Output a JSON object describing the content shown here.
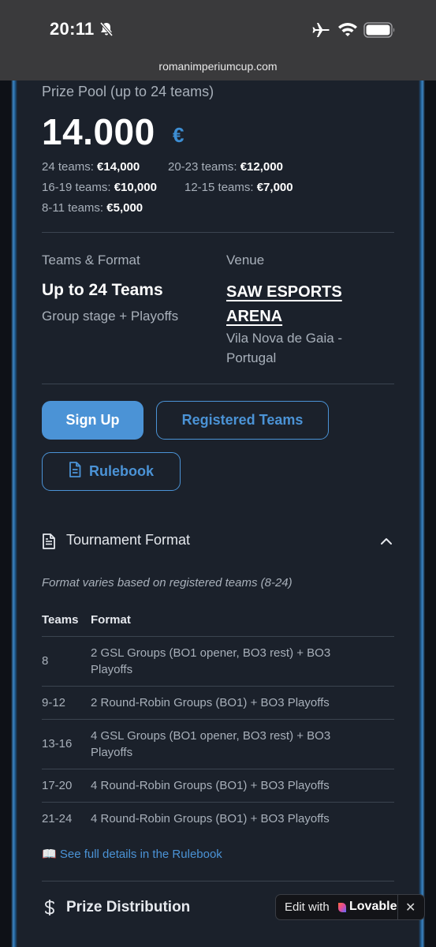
{
  "status_bar": {
    "time": "20:11"
  },
  "browser": {
    "url": "romanimperiumcup.com"
  },
  "prize": {
    "heading": "Prize Pool (up to 24 teams)",
    "amount": "14.000",
    "currency": "€",
    "tiers": [
      {
        "label": "24 teams:",
        "value": "€14,000"
      },
      {
        "label": "20-23 teams:",
        "value": "€12,000"
      },
      {
        "label": "16-19 teams:",
        "value": "€10,000"
      },
      {
        "label": "12-15 teams:",
        "value": "€7,000"
      },
      {
        "label": "8-11 teams:",
        "value": "€5,000"
      }
    ]
  },
  "teams_format": {
    "label": "Teams & Format",
    "value": "Up to 24 Teams",
    "sub": "Group stage + Playoffs"
  },
  "venue": {
    "label": "Venue",
    "name": "SAW ESPORTS ARENA",
    "location": "Vila Nova de Gaia - Portugal"
  },
  "buttons": {
    "signup": "Sign Up",
    "registered": "Registered Teams",
    "rulebook": "Rulebook"
  },
  "tournament_format": {
    "title": "Tournament Format",
    "note": "Format varies based on registered teams (8-24)",
    "columns": [
      "Teams",
      "Format"
    ],
    "rows": [
      {
        "teams": "8",
        "format": "2 GSL Groups (BO1 opener, BO3 rest) + BO3 Playoffs"
      },
      {
        "teams": "9-12",
        "format": "2 Round-Robin Groups (BO1) + BO3 Playoffs"
      },
      {
        "teams": "13-16",
        "format": "4 GSL Groups (BO1 opener, BO3 rest) + BO3 Playoffs"
      },
      {
        "teams": "17-20",
        "format": "4 Round-Robin Groups (BO1) + BO3 Playoffs"
      },
      {
        "teams": "21-24",
        "format": "4 Round-Robin Groups (BO1) + BO3 Playoffs"
      }
    ],
    "rulebook_link": "📖 See full details in the Rulebook"
  },
  "prize_distribution": {
    "title": "Prize Distribution"
  },
  "lovable_badge": {
    "edit_label": "Edit with",
    "brand": "Lovable",
    "close": "✕"
  },
  "colors": {
    "accent": "#4b93d6",
    "background": "#1b212b",
    "currency": "#3d8ed3"
  }
}
